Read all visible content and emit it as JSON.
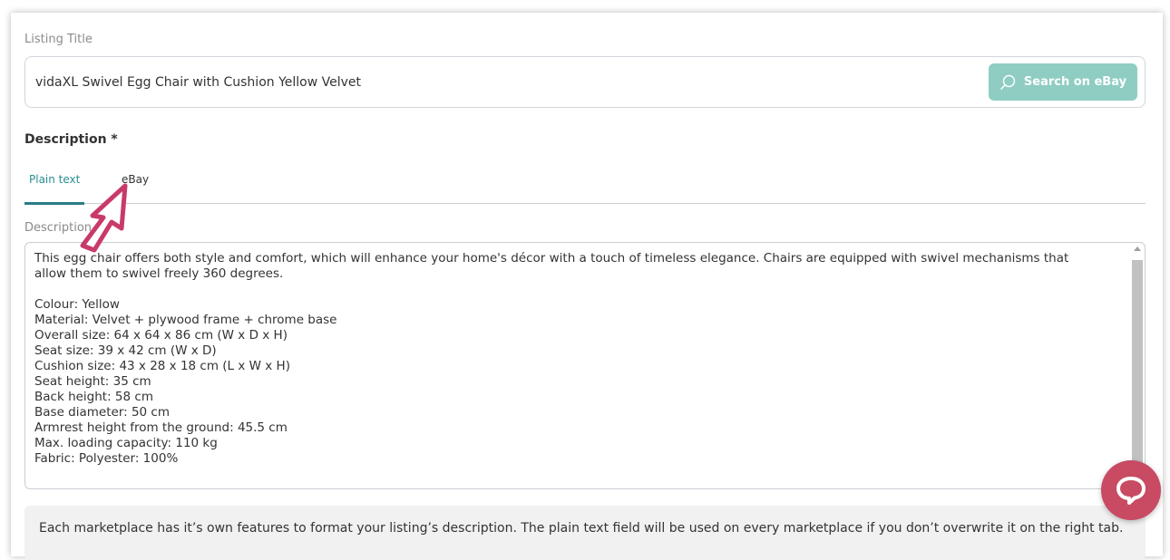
{
  "listing": {
    "label": "Listing Title",
    "value": "vidaXL Swivel Egg Chair with Cushion Yellow Velvet",
    "search_button": "Search on eBay"
  },
  "description": {
    "heading": "Description *",
    "tabs": [
      "Plain text",
      "eBay"
    ],
    "active_tab": "Plain text",
    "field_label": "Description",
    "text": "This egg chair offers both style and comfort, which will enhance your home's décor with a touch of timeless elegance. Chairs are equipped with swivel mechanisms that\nallow them to swivel freely 360 degrees.\n\nColour: Yellow\nMaterial: Velvet + plywood frame + chrome base\nOverall size: 64 x 64 x 86 cm (W x D x H)\nSeat size: 39 x 42 cm (W x D)\nCushion size: 43 x 28 x 18 cm (L x W x H)\nSeat height: 35 cm\nBack height: 58 cm\nBase diameter: 50 cm\nArmrest height from the ground: 45.5 cm\nMax. loading capacity: 110 kg\nFabric: Polyester: 100%"
  },
  "info": {
    "text": "Each marketplace has it’s own features to format your listing’s description. The plain text field will be used on every marketplace if you don’t overwrite it on the right tab."
  },
  "icons": {
    "search": "search-icon",
    "chat": "chat-bubble-icon",
    "cursor": "pointer-arrow-icon"
  },
  "colors": {
    "accent": "#2a8f92",
    "search_button": "#8fcdc2",
    "chat_button": "#c84b63"
  }
}
